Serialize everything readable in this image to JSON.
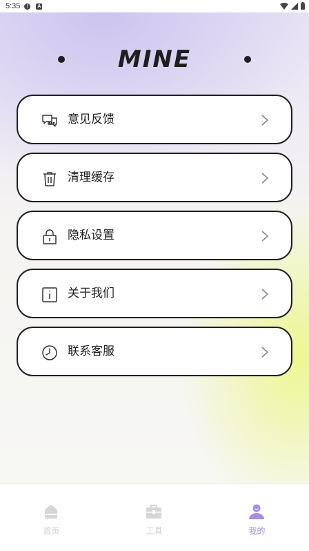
{
  "status_bar": {
    "time": "5:35",
    "icons": [
      "alert-icon",
      "a-icon",
      "wifi-icon",
      "signal-icon",
      "battery-icon"
    ]
  },
  "header": {
    "title": "MINE"
  },
  "menu": {
    "items": [
      {
        "label": "意见反馈",
        "icon": "feedback-chat-icon"
      },
      {
        "label": "清理缓存",
        "icon": "trash-icon"
      },
      {
        "label": "隐私设置",
        "icon": "lock-icon"
      },
      {
        "label": "关于我们",
        "icon": "info-icon"
      },
      {
        "label": "联系客服",
        "icon": "clock-icon"
      }
    ]
  },
  "tabbar": {
    "tabs": [
      {
        "label": "首页",
        "icon": "home-icon",
        "active": false
      },
      {
        "label": "工具",
        "icon": "toolbox-icon",
        "active": false
      },
      {
        "label": "我的",
        "icon": "user-icon",
        "active": true
      }
    ]
  },
  "colors": {
    "accent": "#a88ce6",
    "inactive": "#d0d0d0",
    "border": "#1f1f1f",
    "gradient_purple": "#cdc4f0",
    "gradient_yellow": "#ecf78c"
  }
}
